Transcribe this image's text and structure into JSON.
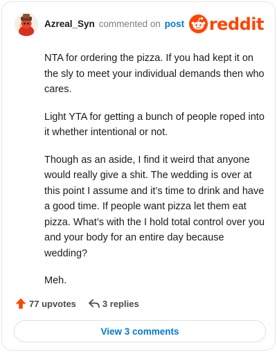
{
  "header": {
    "username": "Azreal_Syn",
    "meta_text": "commented on",
    "post_link": "post",
    "avatar_icon": "user-avatar-icon"
  },
  "brand": {
    "logo_word": "reddit",
    "logo_icon": "reddit-snoo-icon",
    "color": "#ff4500"
  },
  "comment": {
    "paragraphs": [
      "NTA for ordering the pizza. If you had kept it on the sly to meet your individual demands then who cares.",
      "Light YTA for getting a bunch of people roped into it whether intentional or not.",
      "Though as an aside, I find it weird that anyone would really give a shit. The wedding is over at this point I assume and it’s time to drink and have a good time. If people want pizza let them eat pizza. What’s with the I hold total control over you and your body for an entire day because wedding?",
      "Meh."
    ]
  },
  "actions": {
    "upvotes_label": "77 upvotes",
    "upvote_icon": "upvote-arrow-icon",
    "upvote_color": "#ff4500",
    "replies_label": "3 replies",
    "reply_icon": "reply-arrow-icon"
  },
  "footer": {
    "view_comments_label": "View 3 comments",
    "link_color": "#0079d3"
  }
}
